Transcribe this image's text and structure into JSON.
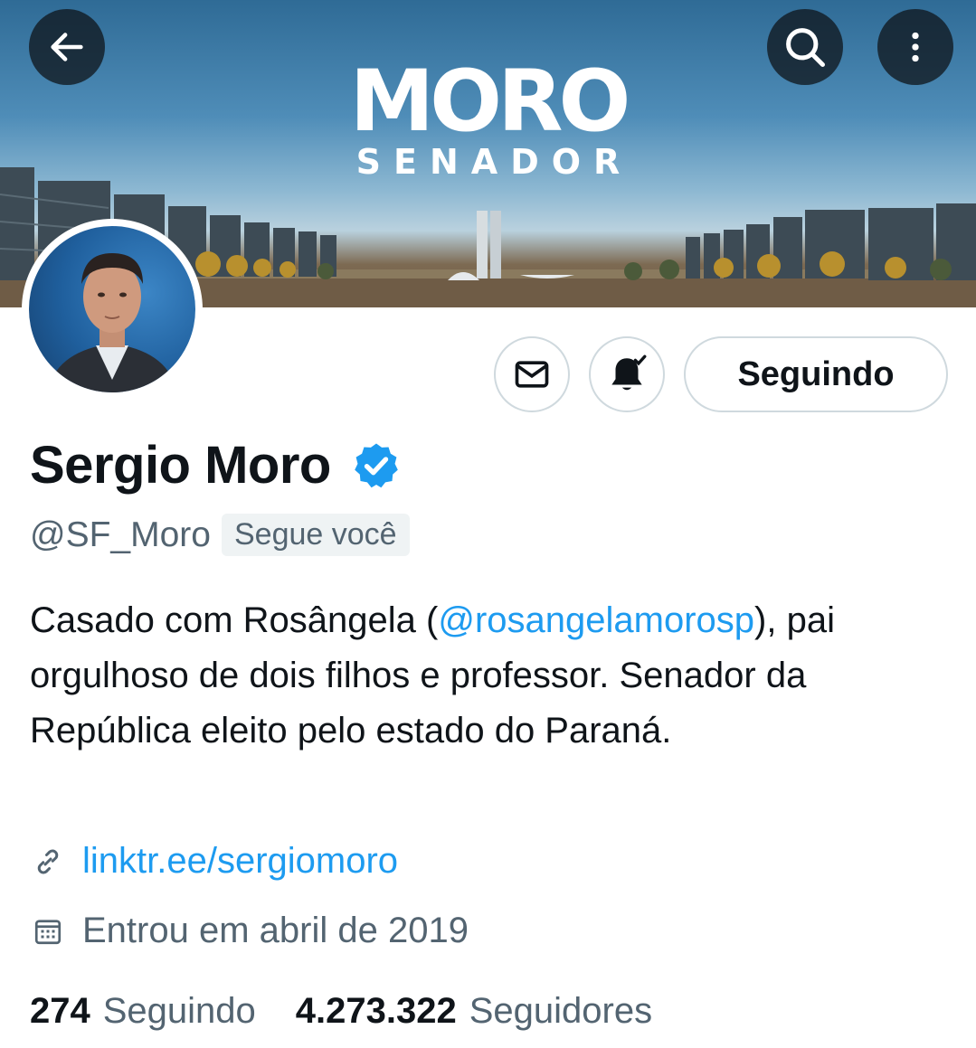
{
  "banner": {
    "title": "MORO",
    "subtitle": "SENADOR"
  },
  "header": {
    "back_icon": "arrow-left-icon",
    "search_icon": "search-icon",
    "more_icon": "more-vertical-icon"
  },
  "actions": {
    "message_icon": "mail-icon",
    "notify_icon": "bell-check-icon",
    "following_label": "Seguindo"
  },
  "profile": {
    "name": "Sergio Moro",
    "verified": true,
    "handle": "@SF_Moro",
    "follows_you": "Segue você",
    "bio_prefix": "Casado com Rosângela (",
    "bio_mention": "@rosangelamorosp",
    "bio_suffix": "), pai orgulhoso de dois filhos e professor. Senador da República eleito pelo estado do Paraná.",
    "link": "linktr.ee/sergiomoro",
    "joined": "Entrou em abril de 2019"
  },
  "stats": {
    "following_count": "274",
    "following_label": "Seguindo",
    "followers_count": "4.273.322",
    "followers_label": "Seguidores"
  },
  "colors": {
    "accent": "#1d9bf0",
    "secondary_text": "#536471",
    "primary_text": "#0f1419"
  }
}
